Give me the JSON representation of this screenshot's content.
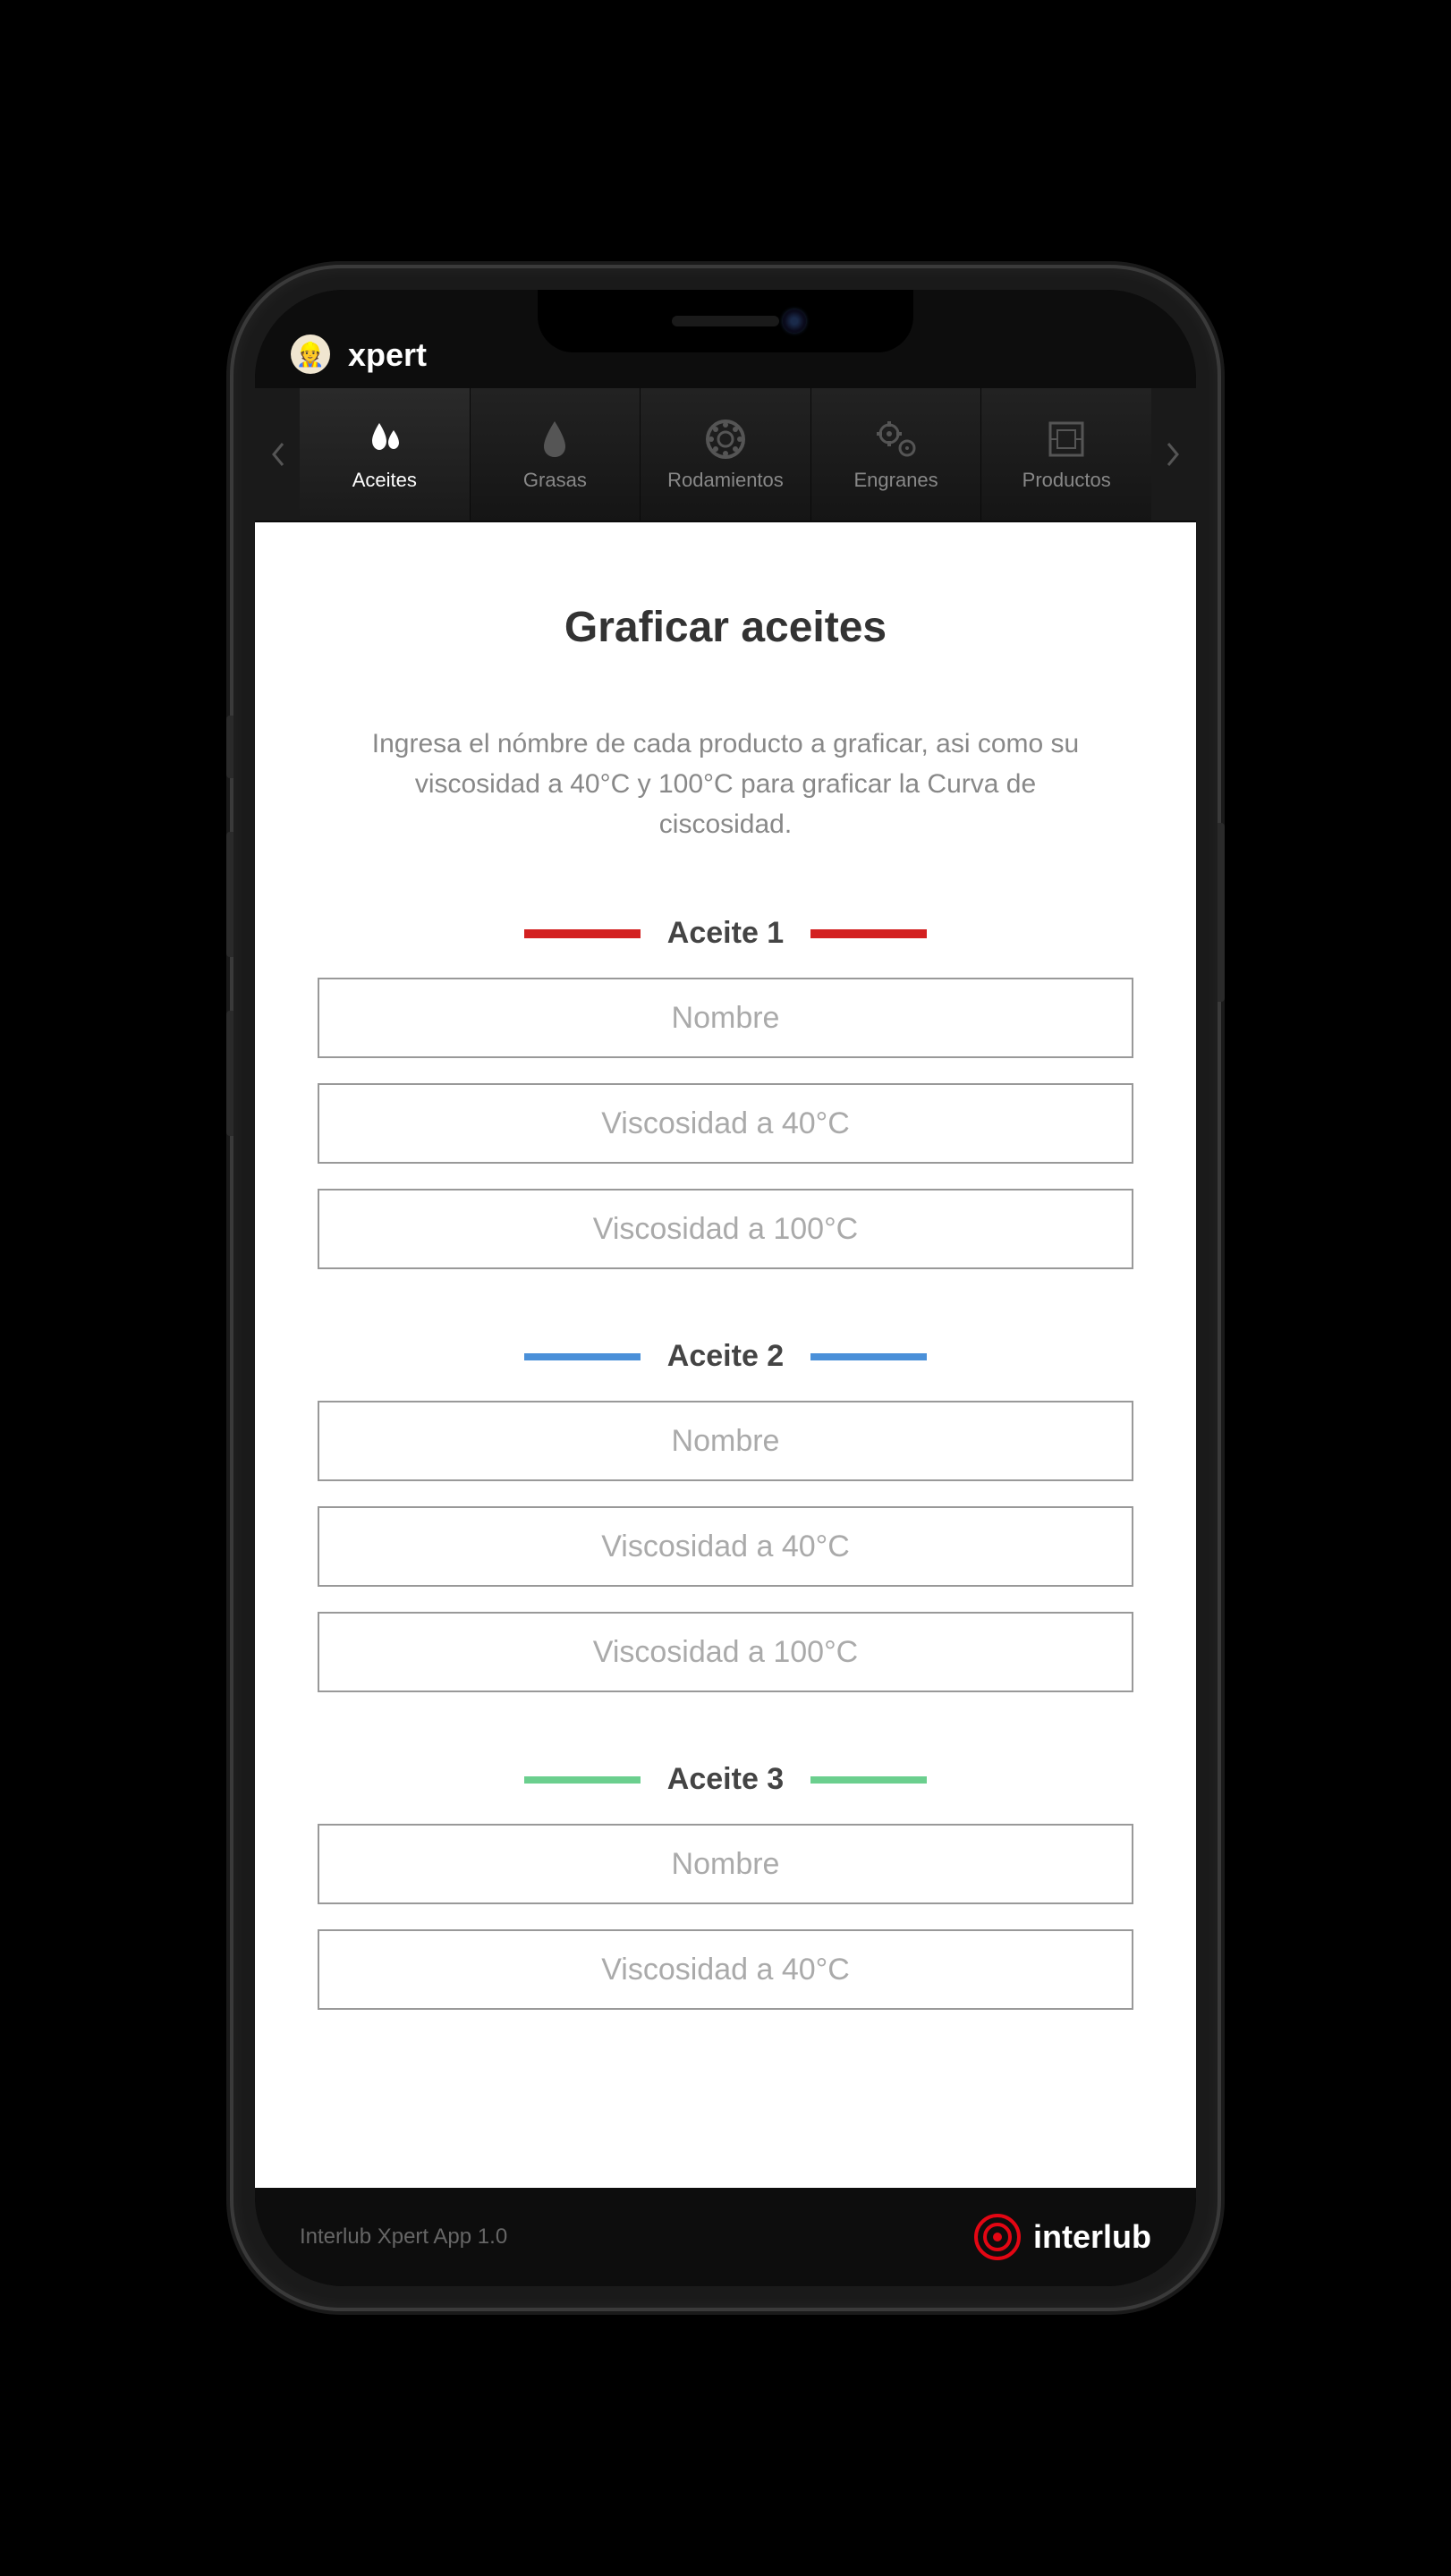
{
  "app": {
    "name": "xpert",
    "logo_emoji": "👷"
  },
  "tabs": [
    {
      "label": "Aceites",
      "active": true
    },
    {
      "label": "Grasas",
      "active": false
    },
    {
      "label": "Rodamientos",
      "active": false
    },
    {
      "label": "Engranes",
      "active": false
    },
    {
      "label": "Productos",
      "active": false
    }
  ],
  "page": {
    "title": "Graficar aceites",
    "instructions": "Ingresa el nómbre de cada producto a graficar, asi como su viscosidad a 40°C y 100°C para graficar la Curva de ciscosidad."
  },
  "placeholders": {
    "name": "Nombre",
    "visc40": "Viscosidad a 40°C",
    "visc100": "Viscosidad a 100°C"
  },
  "oils": [
    {
      "label": "Aceite 1",
      "color": "red"
    },
    {
      "label": "Aceite 2",
      "color": "blue"
    },
    {
      "label": "Aceite 3",
      "color": "green"
    }
  ],
  "footer": {
    "version": "Interlub Xpert App 1.0",
    "brand": "interlub"
  },
  "colors": {
    "accent_red": "#d32020",
    "accent_blue": "#4a90d9",
    "accent_green": "#6bcf8e",
    "brand_red": "#e30613"
  }
}
